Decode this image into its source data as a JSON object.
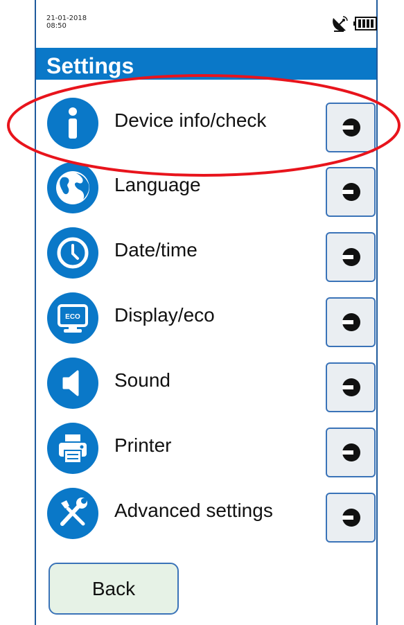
{
  "status": {
    "date": "21-01-2018",
    "time": "08:50",
    "gps_icon": "satellite-dish-icon",
    "battery_icon": "battery-full-icon"
  },
  "header": {
    "title": "Settings"
  },
  "menu": [
    {
      "label": "Device info/check",
      "icon": "info-icon"
    },
    {
      "label": "Language",
      "icon": "globe-icon"
    },
    {
      "label": "Date/time",
      "icon": "clock-icon"
    },
    {
      "label": "Display/eco",
      "icon": "monitor-eco-icon",
      "icon_text": "ECO"
    },
    {
      "label": "Sound",
      "icon": "speaker-icon"
    },
    {
      "label": "Printer",
      "icon": "printer-icon"
    },
    {
      "label": "Advanced settings",
      "icon": "tools-icon"
    }
  ],
  "back_label": "Back",
  "colors": {
    "header": "#0a78c8",
    "icon_bg": "#0a78c8",
    "button_border": "#3a73b8",
    "highlight": "#e8141c",
    "back_bg": "#e6f2e6"
  }
}
